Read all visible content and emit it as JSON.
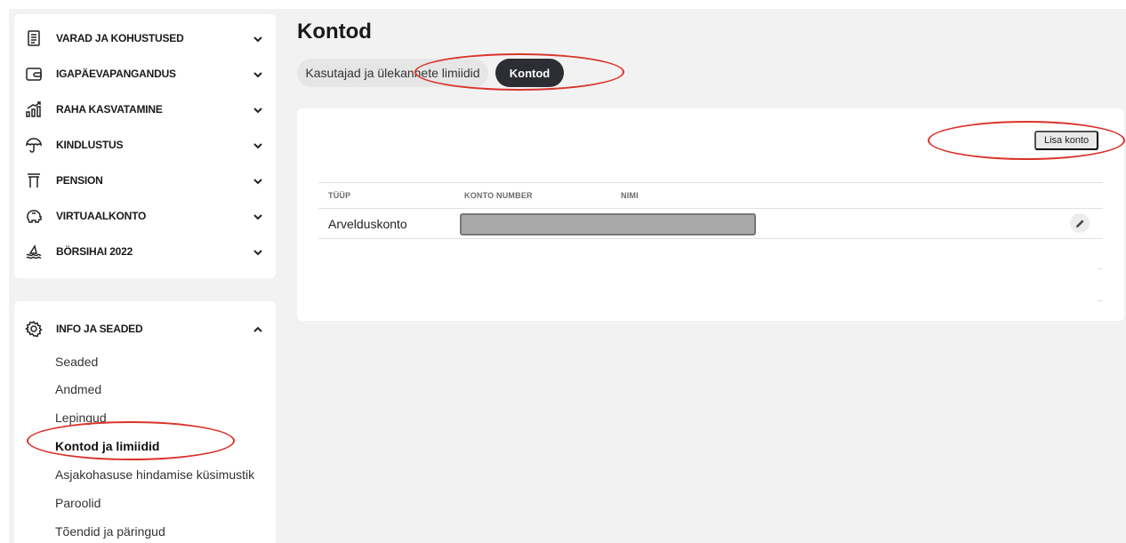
{
  "sidebar": {
    "groups": [
      {
        "label": "VARAD JA KOHUSTUSED",
        "icon": "document-list-icon"
      },
      {
        "label": "IGAPÄEVAPANGANDUS",
        "icon": "wallet-icon"
      },
      {
        "label": "RAHA KASVATAMINE",
        "icon": "growth-chart-icon"
      },
      {
        "label": "KINDLUSTUS",
        "icon": "umbrella-icon"
      },
      {
        "label": "PENSION",
        "icon": "pillar-icon"
      },
      {
        "label": "VIRTUAALKONTO",
        "icon": "piggy-bank-icon"
      },
      {
        "label": "BÖRSIHAI 2022",
        "icon": "shark-waves-icon"
      }
    ],
    "settings": {
      "label": "INFO JA SEADED",
      "icon": "gear-icon",
      "items": [
        {
          "label": "Seaded"
        },
        {
          "label": "Andmed"
        },
        {
          "label": "Lepingud"
        },
        {
          "label": "Kontod ja limiidid",
          "active": true
        },
        {
          "label": "Asjakohasuse hindamise küsimustik"
        },
        {
          "label": "Paroolid"
        },
        {
          "label": "Tõendid ja päringud"
        }
      ]
    }
  },
  "main": {
    "title": "Kontod",
    "tabs": [
      {
        "label": "Kasutajad ja ülekannete limiidid",
        "active": false
      },
      {
        "label": "Kontod",
        "active": true
      }
    ],
    "add_button": "Lisa konto",
    "table": {
      "headers": [
        "TÜÜP",
        "KONTO NUMBER",
        "NIMI"
      ],
      "rows": [
        {
          "type": "Arvelduskonto"
        }
      ]
    }
  },
  "colors": {
    "annotation": "#d9342b",
    "active_tab": "#2c2e33"
  }
}
